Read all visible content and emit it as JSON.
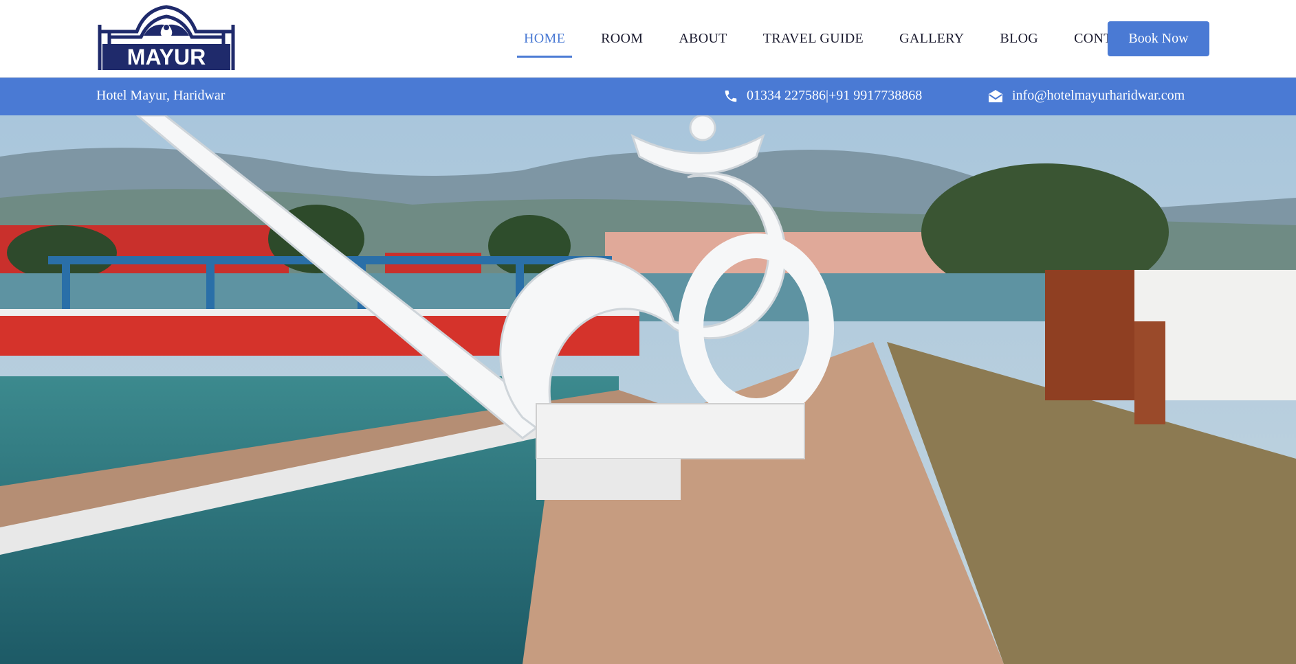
{
  "brand": {
    "logo_text": "MAYUR"
  },
  "nav": {
    "items": [
      {
        "label": "HOME"
      },
      {
        "label": "ROOM"
      },
      {
        "label": "ABOUT"
      },
      {
        "label": "TRAVEL GUIDE"
      },
      {
        "label": "GALLERY"
      },
      {
        "label": "BLOG"
      },
      {
        "label": "CONTACT US"
      }
    ],
    "active_index": 0,
    "book_label": "Book Now"
  },
  "infobar": {
    "hotel_name": "Hotel Mayur, Haridwar",
    "phone": "01334 227586|+91 9917738868",
    "email": "info@hotelmayurharidwar.com",
    "phone_icon": "phone-icon",
    "email_icon": "envelope-icon"
  },
  "colors": {
    "accent": "#4a7ad4",
    "logo": "#1f2a6b",
    "nav_text": "#1a1a2e"
  }
}
